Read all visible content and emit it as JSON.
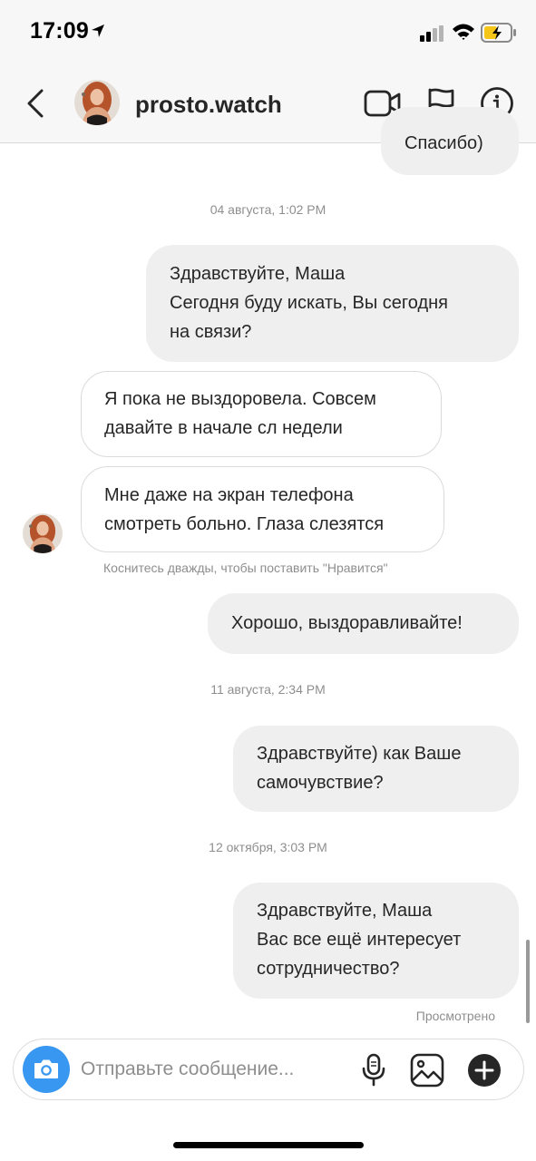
{
  "status_bar": {
    "time": "17:09"
  },
  "header": {
    "username": "prosto.watch"
  },
  "messages": {
    "top_partial": "Спасибо)",
    "ts1": "04 августа, 1:02 PM",
    "m1": {
      "line1": "Здравствуйте, Маша",
      "line2": "Сегодня буду искать, Вы сегодня",
      "line3": "на связи?"
    },
    "m2": {
      "line1": "Я пока не выздоровела. Совсем",
      "line2": "давайте в начале сл недели"
    },
    "m3": {
      "line1": "Мне даже на экран телефона",
      "line2": "смотреть больно. Глаза слезятся"
    },
    "hint": "Коснитесь дважды, чтобы поставить \"Нравится\"",
    "m4": "Хорошо, выздоравливайте!",
    "ts2": "11 августа, 2:34 PM",
    "m5": {
      "line1": "Здравствуйте) как Ваше",
      "line2": "самочувствие?"
    },
    "ts3": "12 октября, 3:03 PM",
    "m6": {
      "line1": "Здравствуйте, Маша",
      "line2": "Вас все ещё интересует",
      "line3": "сотрудничество?"
    },
    "seen": "Просмотрено"
  },
  "composer": {
    "placeholder": "Отправьте сообщение..."
  },
  "icons": {
    "back": "chevron-left-icon",
    "video": "video-camera-icon",
    "flag": "flag-icon",
    "info": "info-icon",
    "camera": "camera-icon",
    "mic": "microphone-icon",
    "gallery": "image-icon",
    "add": "plus-circle-icon"
  },
  "colors": {
    "accent": "#3897f0",
    "outgoing_bubble": "#efefef",
    "battery": "#f5c518"
  }
}
